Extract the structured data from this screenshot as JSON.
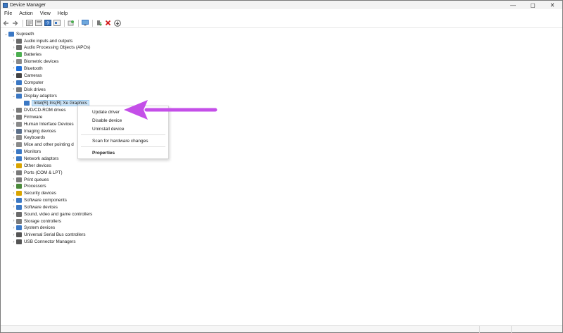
{
  "window": {
    "title": "Device Manager",
    "controls": [
      "—",
      "▢",
      "✕"
    ]
  },
  "menu": [
    "File",
    "Action",
    "View",
    "Help"
  ],
  "toolbar": [
    "back-icon",
    "forward-icon",
    "tree-view-icon",
    "properties-icon",
    "help-icon",
    "show-hidden-icon",
    "scan-icon",
    "monitor-icon",
    "update-driver-icon",
    "uninstall-icon",
    "download-icon"
  ],
  "tree": {
    "root": "Supreeth",
    "items": [
      {
        "label": "Audio inputs and outputs",
        "color": "#6b6b6b"
      },
      {
        "label": "Audio Processing Objects (APOs)",
        "color": "#6b6b6b"
      },
      {
        "label": "Batteries",
        "color": "#4caf50"
      },
      {
        "label": "Biometric devices",
        "color": "#8a8a8a"
      },
      {
        "label": "Bluetooth",
        "color": "#1e6fd9"
      },
      {
        "label": "Cameras",
        "color": "#444444"
      },
      {
        "label": "Computer",
        "color": "#3b78c4"
      },
      {
        "label": "Disk drives",
        "color": "#7a7a7a"
      },
      {
        "label": "Display adaptors",
        "color": "#3b78c4"
      },
      {
        "label": "DVD/CD-ROM drives",
        "color": "#7a7a7a"
      },
      {
        "label": "Firmware",
        "color": "#7a7a7a"
      },
      {
        "label": "Human Interface Devices",
        "color": "#8a8a8a"
      },
      {
        "label": "Imaging devices",
        "color": "#5b6f8a"
      },
      {
        "label": "Keyboards",
        "color": "#8a8a8a"
      },
      {
        "label": "Mice and other pointing d",
        "color": "#8a8a8a"
      },
      {
        "label": "Monitors",
        "color": "#3b78c4"
      },
      {
        "label": "Network adaptors",
        "color": "#3b78c4"
      },
      {
        "label": "Other devices",
        "color": "#d9a400"
      },
      {
        "label": "Ports (COM & LPT)",
        "color": "#7a7a7a"
      },
      {
        "label": "Print queues",
        "color": "#7a7a7a"
      },
      {
        "label": "Processors",
        "color": "#4a8a3a"
      },
      {
        "label": "Security devices",
        "color": "#d9a400"
      },
      {
        "label": "Software components",
        "color": "#3b78c4"
      },
      {
        "label": "Software devices",
        "color": "#3b78c4"
      },
      {
        "label": "Sound, video and game controllers",
        "color": "#6b6b6b"
      },
      {
        "label": "Storage controllers",
        "color": "#7a7a7a"
      },
      {
        "label": "System devices",
        "color": "#3b78c4"
      },
      {
        "label": "Universal Serial Bus controllers",
        "color": "#555555"
      },
      {
        "label": "USB Connector Managers",
        "color": "#555555"
      }
    ],
    "child": {
      "label": "Intel(R) Iris(R) Xe Graphics",
      "parent": "Display adaptors"
    }
  },
  "context_menu": {
    "items": [
      "Update driver",
      "Disable device",
      "Uninstall device",
      "Scan for hardware changes",
      "Properties"
    ]
  },
  "annotation": {
    "arrow_color": "#c44fe8",
    "arrow_target": "Update driver"
  }
}
